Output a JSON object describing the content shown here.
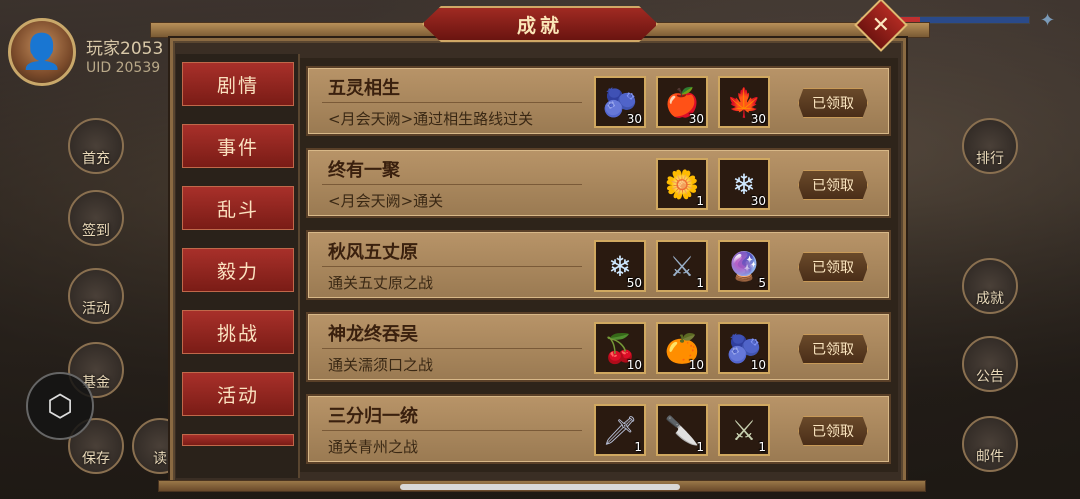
{
  "player": {
    "name": "玩家2053",
    "uid": "UID  20539"
  },
  "left_hud": [
    {
      "label": "首充",
      "icon": "gift-icon"
    },
    {
      "label": "签到",
      "icon": "calendar-icon"
    },
    {
      "label": "活动",
      "icon": "flag-icon"
    },
    {
      "label": "基金",
      "icon": "plant-icon"
    },
    {
      "label": "保存",
      "icon": "save-icon"
    },
    {
      "label": "读",
      "icon": "scroll-icon"
    }
  ],
  "right_hud": [
    {
      "label": "排行",
      "icon": "ranking-icon"
    },
    {
      "label": "成就",
      "icon": "achievement-icon"
    },
    {
      "label": "公告",
      "icon": "notice-icon"
    },
    {
      "label": "邮件",
      "icon": "mail-icon"
    }
  ],
  "panel": {
    "title": "成就",
    "close_symbol": "✕"
  },
  "categories": [
    "剧情",
    "事件",
    "乱斗",
    "毅力",
    "挑战",
    "活动"
  ],
  "achievements": [
    {
      "title": "五灵相生",
      "desc": "<月会天阙>通过相生路线过关",
      "button": "已领取",
      "rewards": [
        {
          "icon": "blue-fruit-icon",
          "glyph": "🫐",
          "count": "30"
        },
        {
          "icon": "red-fruit-icon",
          "glyph": "🍎",
          "count": "30"
        },
        {
          "icon": "red-leaf-icon",
          "glyph": "🍁",
          "count": "30"
        }
      ]
    },
    {
      "title": "终有一聚",
      "desc": "<月会天阙>通关",
      "button": "已领取",
      "rewards": [
        {
          "icon": "flower-icon",
          "glyph": "🌼",
          "count": "1"
        },
        {
          "icon": "crystal-icon",
          "glyph": "❄",
          "count": "30"
        }
      ]
    },
    {
      "title": "秋风五丈原",
      "desc": "通关五丈原之战",
      "button": "已领取",
      "rewards": [
        {
          "icon": "crystal-icon",
          "glyph": "❄",
          "count": "50"
        },
        {
          "icon": "sword-icon",
          "glyph": "⚔",
          "count": "1"
        },
        {
          "icon": "rainbow-orb-icon",
          "glyph": "🔮",
          "count": "5"
        }
      ]
    },
    {
      "title": "神龙终吞吴",
      "desc": "通关濡须口之战",
      "button": "已领取",
      "rewards": [
        {
          "icon": "red-berries-icon",
          "glyph": "🍒",
          "count": "10"
        },
        {
          "icon": "orange-berries-icon",
          "glyph": "🍊",
          "count": "10"
        },
        {
          "icon": "blue-berries-icon",
          "glyph": "🫐",
          "count": "10"
        }
      ]
    },
    {
      "title": "三分归一统",
      "desc": "通关青州之战",
      "button": "已领取",
      "rewards": [
        {
          "icon": "spear-icon",
          "glyph": "🗡",
          "count": "1"
        },
        {
          "icon": "blade-icon",
          "glyph": "🔪",
          "count": "1"
        },
        {
          "icon": "halberd-icon",
          "glyph": "⚔",
          "count": "1"
        }
      ]
    }
  ]
}
